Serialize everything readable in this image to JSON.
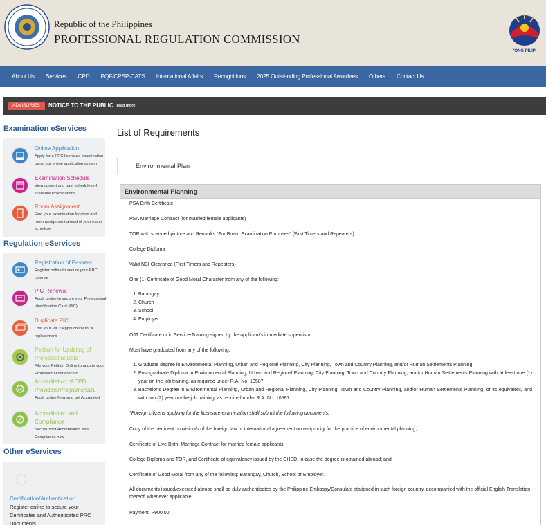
{
  "header": {
    "org_line1": "Republic of the Philippines",
    "org_line2": "PROFESSIONAL REGULATION COMMISSION",
    "seal_text_top": "PROFESSIONAL REGULATION COMMISSION",
    "seal_text_bottom": "REPUBLIC OF THE PHILIPPINES",
    "bp_logo_text": "\"ONG PILIPI"
  },
  "nav": {
    "items": [
      "About Us",
      "Services",
      "CPD",
      "PQF/CPSP-CATS",
      "International Affairs",
      "Recognitions",
      "2025 Outstanding Professional Awardees",
      "Others",
      "Contact Us"
    ]
  },
  "advisory": {
    "badge": "ADVISORIES",
    "text": "NOTICE TO THE PUBLIC",
    "more": "(read more)"
  },
  "sidebar": {
    "exam_heading": "Examination eServices",
    "exam_items": [
      {
        "title": "Online Application",
        "desc": "Apply for a PRC licensure examination using our online application system",
        "color": "#3e87c6"
      },
      {
        "title": "Examination Schedule",
        "desc": "View current and past schedules of licensure examinations",
        "color": "#c7238b"
      },
      {
        "title": "Room Assignment",
        "desc": "Find your examination location and room assignment ahead of your exam schedule",
        "color": "#e85c3a"
      }
    ],
    "reg_heading": "Regulation eServices",
    "reg_items": [
      {
        "title": "Registration of Passers",
        "desc": "Register online to secure your PRC License",
        "color": "#3e87c6"
      },
      {
        "title": "PIC Renewal",
        "desc": "Apply online to secure your Professional Identification Card (PIC)",
        "color": "#c7238b"
      },
      {
        "title": "Duplicate PIC",
        "desc": "Lost your PIC? Apply online for a replacement",
        "color": "#e85c3a"
      },
      {
        "title": "Petition for Updating of Professional Data",
        "desc": "File your Petition Online to update your Professional data/record",
        "color": "#a7c94a"
      },
      {
        "title": "Accreditation of CPD Providers/Programs/SDL",
        "desc": "Apply online Now and get Accredited",
        "color": "#8fc24a"
      },
      {
        "title": "Accreditation and Compliance",
        "desc": "Secure Your Accreditation and Compliance now",
        "color": "#8fc24a"
      }
    ],
    "other_heading": "Other eServices",
    "other_item": {
      "title": "Certification/Authentication",
      "desc": "Register online to secure your Certificates and Authenticated PRC Documents"
    }
  },
  "main": {
    "title": "List of Requirements",
    "selected": "Environmental Plan",
    "panel_title": "Environmental Planning",
    "r1": "PSA Birth Certificate",
    "r2": "PSA Marriage Contract (for married female applicants)",
    "r3": "TOR with scanned picture and Remarks “For Board Examination Purposes” (First Timers and Repeaters)",
    "r4": "College Diploma",
    "r5": "Valid NBI Clearance (First Timers and Repeaters)",
    "r6": "One (1) Certificate of Good Moral Character from any of the following:",
    "gm_list": [
      "Barangay",
      "Church",
      "School",
      "Employer"
    ],
    "r7": "OJT Certificate or in Service-Training signed by the applicant’s immediate supervisor",
    "r8": "Must have graduated from any of the following:",
    "grad_list": [
      "Graduate degree in Environmental Planning, Urban and Regional Planning, City Planning, Town and Country Planning, and/or Human Settlements Planning.",
      "Post-graduate Diploma in Environmental Planning, Urban and Regional Planning, City Planning, Town and Country Planning, and/or Human Settlements Planning with at least one (1) year on-the-job training, as required under R.A. No. 10587.",
      "Bachelor’s Degree in Environmental Planning, Urban and Regional Planning, City Planning, Town and Country Planning, and/or Human Settlements Planning, or its equivalent, and with two (2) year on-the-job training, as required under R.A. No. 10587."
    ],
    "foreign_heading": "*Foreign citizens applying for the licensure examination shall submit the following documents:",
    "f1": "Copy of the pertinent provision/s of the foreign law or international agreement on reciprocity for the practice of environmental planning;",
    "f2": "Certificate of Live Birth, Marriage Contract for married female applicants;",
    "f3": "College Diploma and TOR, and Certificate of equivalency issued by the CHED, in case the degree is obtained abroad; and",
    "f4": "Certificate of Good Moral from any of the following: Barangay, Church, School or Employer.",
    "f5": "All documents issued/executed abroad shall be duly authenticated by the Philippine Embassy/Consulate stationed in such foreign country, accompanied with the official English Translation thereof, whenever applicable",
    "payment": "Payment: P900.00"
  }
}
